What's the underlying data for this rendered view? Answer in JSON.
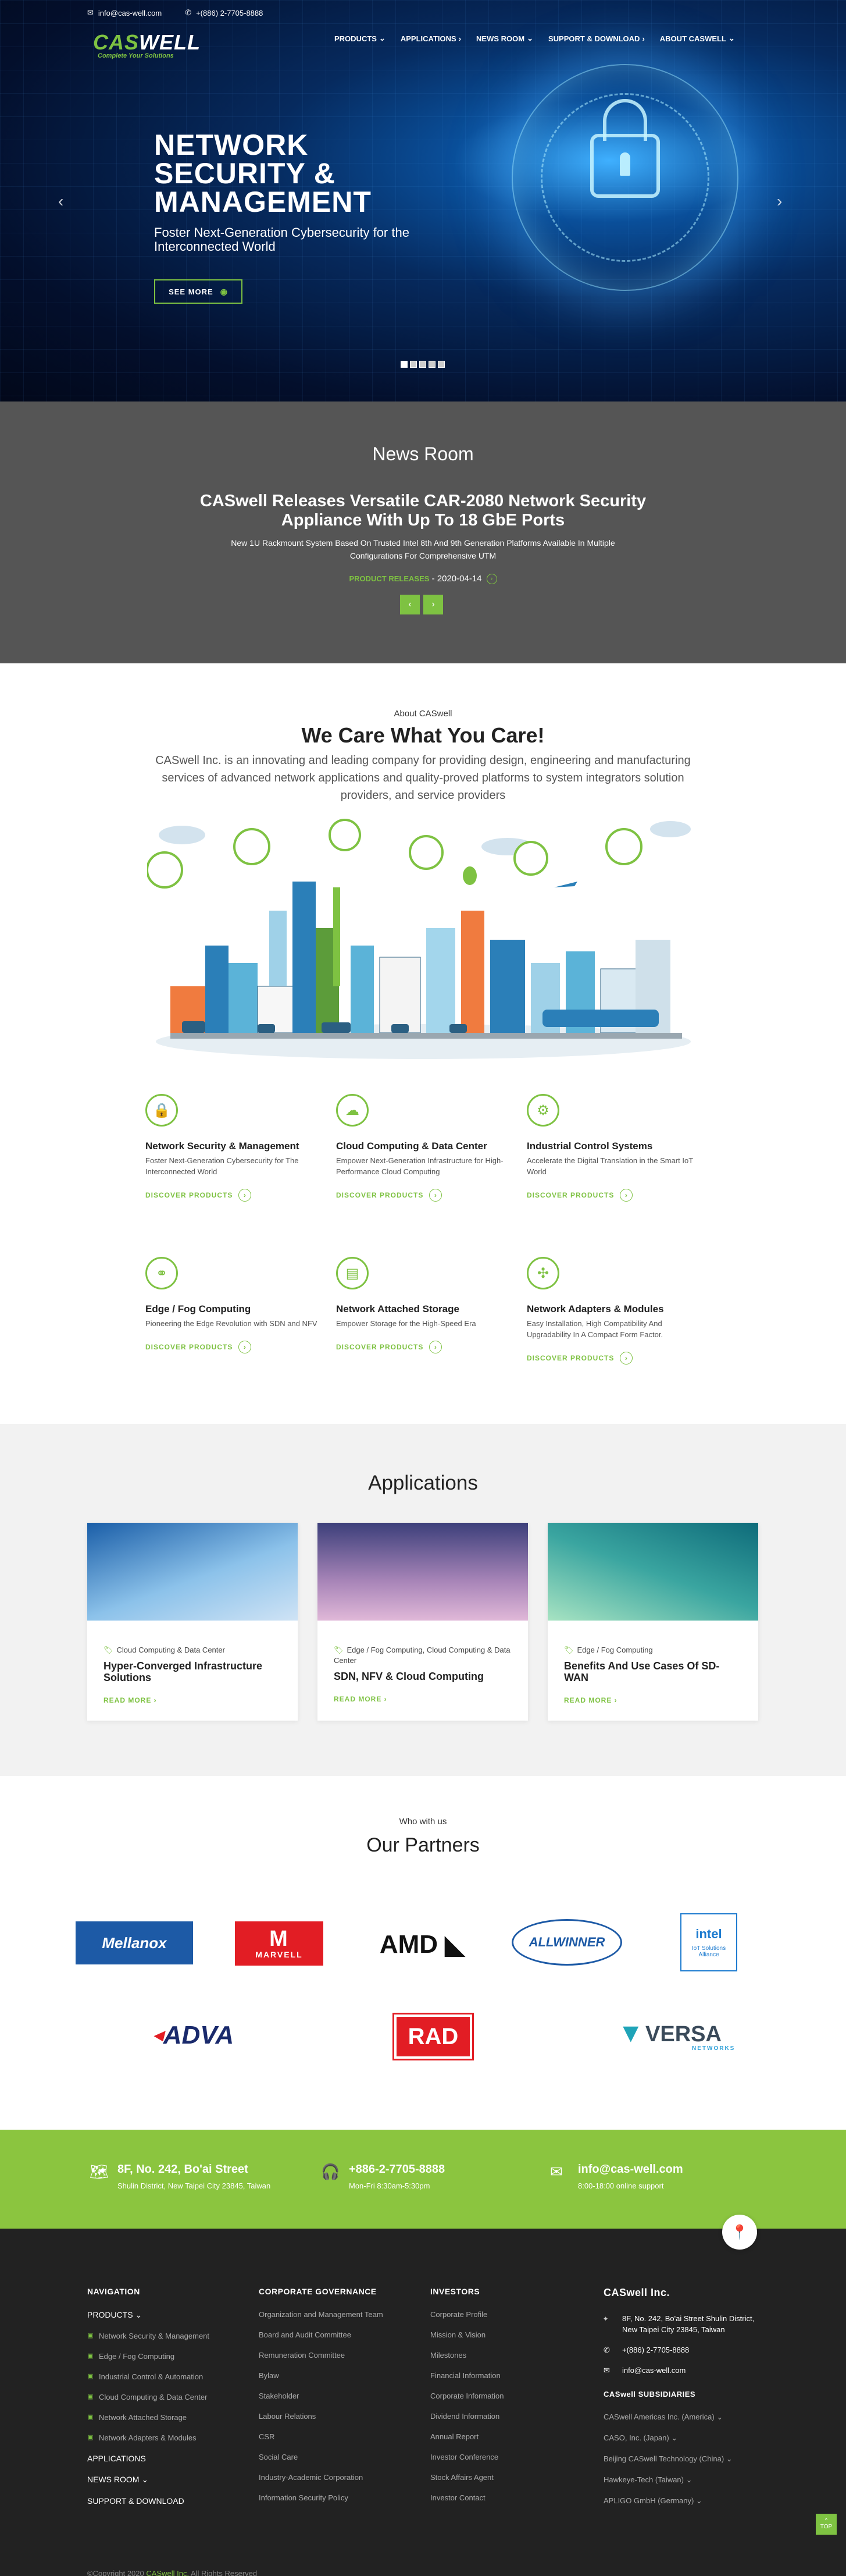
{
  "topbar": {
    "email": "info@cas-well.com",
    "phone": "+(886) 2-7705-8888"
  },
  "logo": {
    "brand_a": "CAS",
    "brand_b": "WELL",
    "tagline": "Complete Your Solutions"
  },
  "nav": [
    {
      "label": "PRODUCTS",
      "caret": "⌄"
    },
    {
      "label": "APPLICATIONS",
      "caret": "›"
    },
    {
      "label": "NEWS ROOM",
      "caret": "⌄"
    },
    {
      "label": "SUPPORT & DOWNLOAD",
      "caret": "›"
    },
    {
      "label": "ABOUT CASWELL",
      "caret": "⌄"
    }
  ],
  "hero": {
    "title_l1": "NETWORK",
    "title_l2": "SECURITY &",
    "title_l3": "MANAGEMENT",
    "subtitle": "Foster Next-Generation Cybersecurity for the Interconnected World",
    "cta": "SEE MORE"
  },
  "news": {
    "heading": "News Room",
    "headline": "CASwell Releases Versatile CAR-2080 Network Security Appliance With Up To 18 GbE Ports",
    "summary": "New 1U Rackmount System Based On Trusted Intel 8th And 9th Generation Platforms Available In Multiple Configurations For Comprehensive UTM",
    "category": "PRODUCT RELEASES",
    "separator": " - ",
    "date": "2020-04-14"
  },
  "about": {
    "kicker": "About CASwell",
    "title": "We Care What You Care!",
    "text": "CASwell Inc. is an innovating and leading company for providing design, engineering and manufacturing services of advanced network applications and quality-proved platforms to system integrators solution providers, and service providers"
  },
  "services": [
    {
      "title": "Network Security & Management",
      "desc": "Foster Next-Generation Cybersecurity for The Interconnected World",
      "link": "DISCOVER PRODUCTS",
      "icon": "lock-icon"
    },
    {
      "title": "Cloud Computing & Data Center",
      "desc": "Empower Next-Generation Infrastructure for High-Performance Cloud Computing",
      "link": "DISCOVER PRODUCTS",
      "icon": "cloud-icon"
    },
    {
      "title": "Industrial Control Systems",
      "desc": "Accelerate the Digital Translation in the Smart IoT World",
      "link": "DISCOVER PRODUCTS",
      "icon": "industry-icon"
    },
    {
      "title": "Edge / Fog Computing",
      "desc": "Pioneering the Edge Revolution with SDN and NFV",
      "link": "DISCOVER PRODUCTS",
      "icon": "edge-icon"
    },
    {
      "title": "Network Attached Storage",
      "desc": "Empower Storage for the High-Speed Era",
      "link": "DISCOVER PRODUCTS",
      "icon": "storage-icon"
    },
    {
      "title": "Network Adapters & Modules",
      "desc": "Easy Installation, High Compatibility And Upgradability In A Compact Form Factor.",
      "link": "DISCOVER PRODUCTS",
      "icon": "puzzle-icon"
    }
  ],
  "applications": {
    "heading": "Applications",
    "cards": [
      {
        "category": "Cloud Computing & Data Center",
        "title": "Hyper-Converged Infrastructure Solutions",
        "link": "READ MORE",
        "color_a": "#1a5ea8",
        "color_b": "#cfe3f5"
      },
      {
        "category": "Edge / Fog Computing, Cloud Computing & Data Center",
        "title": "SDN, NFV & Cloud Computing",
        "link": "READ MORE",
        "color_a": "#3c3f7a",
        "color_b": "#e0b8d8"
      },
      {
        "category": "Edge / Fog Computing",
        "title": "Benefits And Use Cases Of SD-WAN",
        "link": "READ MORE",
        "color_a": "#0e6b7a",
        "color_b": "#a7e3c2"
      }
    ]
  },
  "partners": {
    "kicker": "Who with us",
    "title": "Our Partners",
    "logos": [
      "Mellanox",
      "MARVELL",
      "AMD",
      "ALLWINNER",
      "intel",
      "IoT Solutions Alliance",
      "ADVA",
      "RAD",
      "VERSA",
      "NETWORKS"
    ]
  },
  "contact": {
    "address_title": "8F, No. 242, Bo'ai Street",
    "address_sub": "Shulin District, New Taipei City 23845, Taiwan",
    "phone_title": "+886-2-7705-8888",
    "phone_sub": "Mon-Fri 8:30am-5:30pm",
    "email_title": "info@cas-well.com",
    "email_sub": "8:00-18:00 online support"
  },
  "footer": {
    "nav_heading": "NAVIGATION",
    "nav": [
      "PRODUCTS",
      "APPLICATIONS",
      "NEWS ROOM",
      "SUPPORT & DOWNLOAD"
    ],
    "nav_products_sub": [
      "Network Security & Management",
      "Edge / Fog Computing",
      "Industrial Control & Automation",
      "Cloud Computing & Data Center",
      "Network Attached Storage",
      "Network Adapters & Modules"
    ],
    "gov_heading": "CORPORATE GOVERNANCE",
    "gov": [
      "Organization and Management Team",
      "Board and Audit Committee",
      "Remuneration Committee",
      "Bylaw",
      "Stakeholder",
      "Labour Relations",
      "CSR",
      "Social Care",
      "Industry-Academic Corporation",
      "Information Security Policy"
    ],
    "inv_heading": "INVESTORS",
    "inv": [
      "Corporate Profile",
      "Mission & Vision",
      "Milestones",
      "Financial Information",
      "Corporate Information",
      "Dividend Information",
      "Annual Report",
      "Investor Conference",
      "Stock Affairs Agent",
      "Investor Contact"
    ],
    "company": "CASwell Inc.",
    "address": "8F, No. 242, Bo'ai Street Shulin District, New Taipei City 23845, Taiwan",
    "phone": "+(886) 2-7705-8888",
    "email": "info@cas-well.com",
    "subs_heading": "CASwell SUBSIDIARIES",
    "subs": [
      "CASwell Americas Inc. (America)",
      "CASO, Inc. (Japan)",
      "Beijing CASwell Technology (China)",
      "Hawkeye-Tech (Taiwan)",
      "APLIGO GmbH (Germany)"
    ],
    "copyright_pre": "©Copyright 2020 ",
    "copyright_brand": "CASwell Inc.",
    "copyright_post": " All Rights Reserved",
    "top": "TOP"
  },
  "colors": {
    "accent": "#7ec242",
    "news_bg": "#555555",
    "footer_bg": "#222222",
    "contact_bg": "#8bc53f"
  }
}
